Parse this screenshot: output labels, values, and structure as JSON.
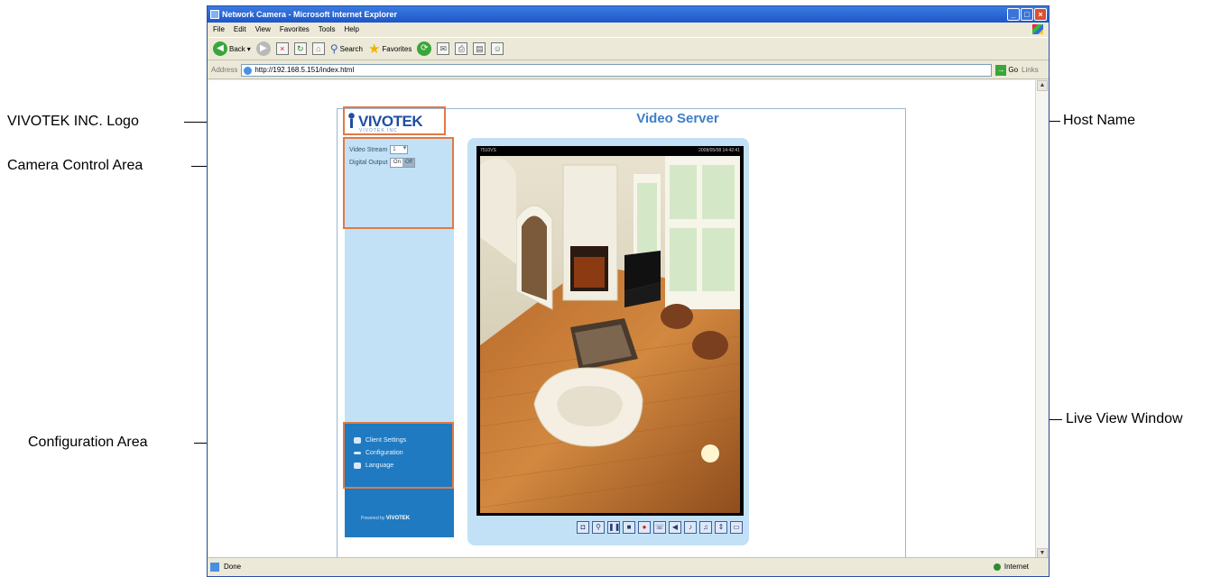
{
  "annotations": {
    "logo": "VIVOTEK INC. Logo",
    "camera_control": "Camera Control Area",
    "configuration": "Configuration Area",
    "host_name": "Host Name",
    "live_view": "Live View Window"
  },
  "browser": {
    "title": "Network Camera - Microsoft Internet Explorer",
    "menu": [
      "File",
      "Edit",
      "View",
      "Favorites",
      "Tools",
      "Help"
    ],
    "toolbar": {
      "back": "Back",
      "search": "Search",
      "favorites": "Favorites"
    },
    "address_label": "Address",
    "address_url": "http://192.168.5.151/index.html",
    "go": "Go",
    "links": "Links",
    "status_text": "Done",
    "zone": "Internet"
  },
  "page": {
    "logo_text": "VIVOTEK",
    "logo_tagline": "VIVOTEK INC",
    "host_name": "Video Server",
    "controls": {
      "video_stream_label": "Video Stream",
      "video_stream_value": "1",
      "digital_output_label": "Digital Output",
      "digital_output_on": "On",
      "digital_output_off": "Off"
    },
    "config": {
      "client_settings": "Client Settings",
      "configuration": "Configuration",
      "language": "Language"
    },
    "powered_by_label": "Powered by",
    "powered_by_brand": "VIVOTEK",
    "video": {
      "channel_label": "7510VS",
      "timestamp": "2008/05/08 14:42:41"
    }
  },
  "colors": {
    "callout_box": "#e07a45",
    "panel_blue": "#c2e1f6",
    "config_blue": "#1f7ac2",
    "host_name": "#3d7fc7"
  },
  "icons": [
    "snapshot-icon",
    "zoom-icon",
    "pause-icon",
    "stop-icon",
    "record-icon",
    "talk-icon",
    "volume-icon",
    "microphone-icon",
    "speaker-icon",
    "full-screen-icon",
    "status-icon"
  ]
}
